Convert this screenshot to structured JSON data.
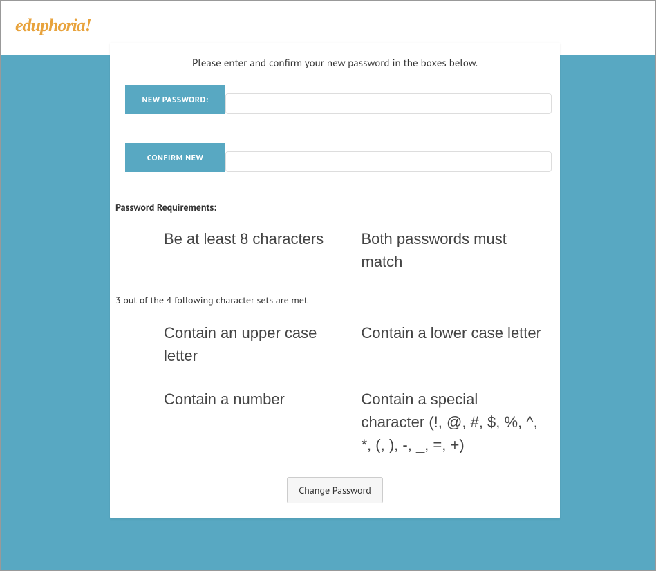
{
  "logo": "eduphoria!",
  "card": {
    "instruction": "Please enter and confirm your new password in the boxes below.",
    "newPasswordLabel": "NEW PASSWORD:",
    "confirmNewLabel": "CONFIRM NEW",
    "newPasswordValue": "",
    "confirmNewValue": "",
    "requirementsTitle": "Password Requirements:",
    "reqPrimary": [
      "Be at least 8 characters",
      "Both passwords must match"
    ],
    "subHeading": "3 out of the 4 following character sets are met",
    "reqSecondary": [
      "Contain an upper case letter",
      "Contain a lower case letter",
      "Contain a number",
      "Contain a special character (!, @, #, $, %, ^, *, (, ), -, _, =, +)"
    ],
    "buttonLabel": "Change Password"
  }
}
